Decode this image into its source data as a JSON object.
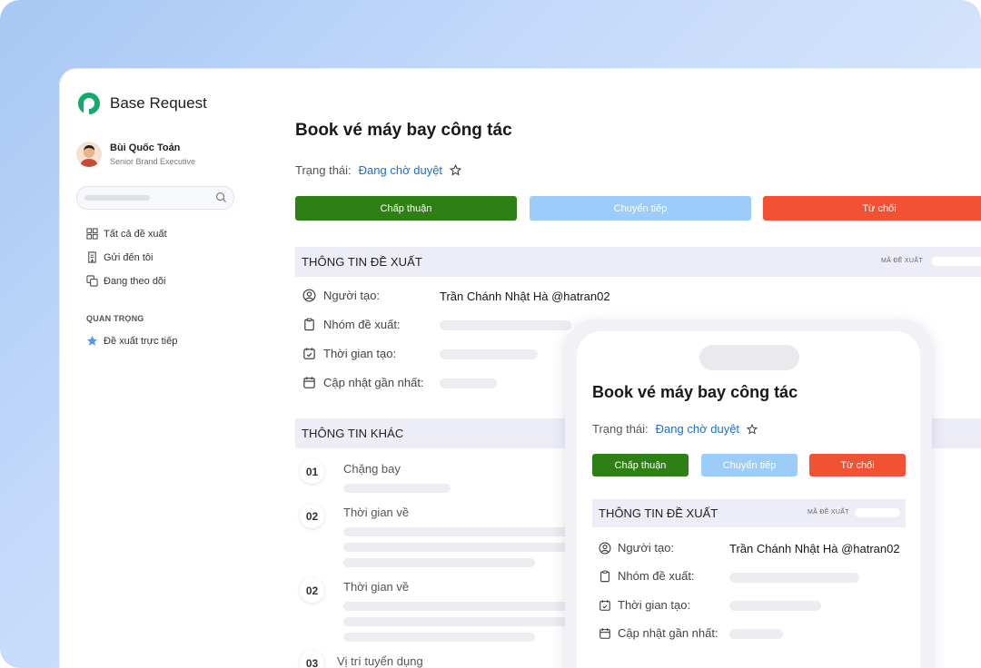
{
  "app": {
    "name": "Base Request"
  },
  "user": {
    "name": "Bùi Quốc Toản",
    "role": "Senior Brand Executive"
  },
  "sidebar": {
    "nav": [
      {
        "label": "Tất cả đề xuất",
        "icon": "grid-icon"
      },
      {
        "label": "Gửi đến tôi",
        "icon": "inbox-doc-icon"
      },
      {
        "label": "Đang theo dõi",
        "icon": "copy-icon"
      }
    ],
    "section_title": "QUAN TRỌNG",
    "important": [
      {
        "label": "Đề xuất trực tiếp",
        "icon": "star-icon"
      }
    ]
  },
  "request": {
    "title": "Book vé máy bay công tác",
    "status_label": "Trạng thái:",
    "status_value": "Đang chờ duyệt"
  },
  "actions": {
    "approve": "Chấp thuận",
    "forward": "Chuyển tiếp",
    "reject": "Từ chối"
  },
  "info_section": {
    "title": "THÔNG TIN ĐỀ XUẤT",
    "code_label": "MÃ ĐỀ XUẤT",
    "fields": [
      {
        "label": "Người tạo:",
        "value": "Trần Chánh Nhật Hà @hatran02",
        "icon": "user-circle-icon"
      },
      {
        "label": "Nhóm đề xuất:",
        "value": "",
        "icon": "clipboard-icon"
      },
      {
        "label": "Thời gian tạo:",
        "value": "",
        "icon": "calendar-check-icon"
      },
      {
        "label": "Cập nhật gần nhất:",
        "value": "",
        "icon": "calendar-icon"
      }
    ]
  },
  "other_section": {
    "title": "THÔNG TIN KHÁC",
    "items": [
      {
        "number": "01",
        "label": "Chặng bay"
      },
      {
        "number": "02",
        "label": "Thời gian về"
      },
      {
        "number": "02",
        "label": "Thời gian về"
      },
      {
        "number": "03",
        "label": "Vị trí tuyển dụng"
      }
    ]
  },
  "colors": {
    "approve": "#2f8014",
    "forward": "#9ccdfa",
    "reject": "#f25233",
    "status_link": "#1a6fd1",
    "brand": "#17a86b"
  }
}
